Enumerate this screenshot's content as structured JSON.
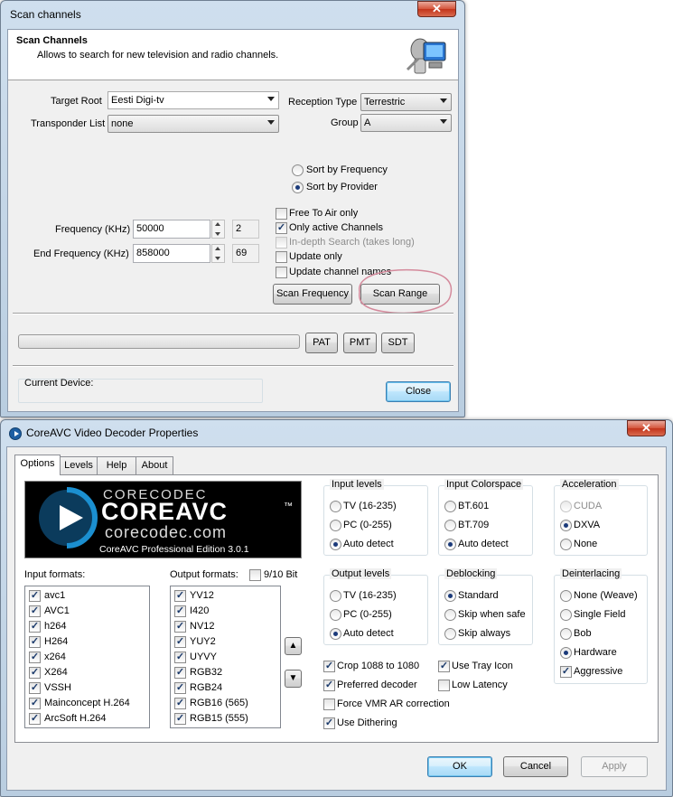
{
  "scan_window": {
    "title": "Scan channels",
    "close": "✕",
    "header_title": "Scan Channels",
    "header_desc": "Allows to search for new television and radio channels.",
    "target_root_label": "Target Root",
    "target_root_value": "Eesti Digi-tv",
    "transponder_list_label": "Transponder List",
    "transponder_list_value": "none",
    "reception_type_label": "Reception Type",
    "reception_type_value": "Terrestric",
    "group_label": "Group",
    "group_value": "A",
    "sort_by_frequency": "Sort by Frequency",
    "sort_by_provider": "Sort by Provider",
    "frequency_label": "Frequency (KHz)",
    "frequency_value": "50000",
    "frequency_channel": "2",
    "end_frequency_label": "End  Frequency (KHz)",
    "end_frequency_value": "858000",
    "end_frequency_channel": "69",
    "free_to_air": "Free To Air only",
    "only_active": "Only active Channels",
    "in_depth": "In-depth Search (takes long)",
    "update_only": "Update only",
    "update_names": "Update channel names",
    "scan_frequency": "Scan Frequency",
    "scan_range": "Scan Range",
    "pat": "PAT",
    "pmt": "PMT",
    "sdt": "SDT",
    "current_device_label": "Current Device:",
    "close_button": "Close"
  },
  "coreavc_window": {
    "title": "CoreAVC Video Decoder Properties",
    "close": "✕",
    "tabs": [
      "Options",
      "Levels",
      "Help",
      "About"
    ],
    "logo": {
      "brand_small": "CORECODEC",
      "brand_big": "COREAVC",
      "tm": "™",
      "url": "corecodec.com",
      "edition": "CoreAVC Professional Edition 3.0.1"
    },
    "input_formats_label": "Input formats:",
    "input_formats": [
      "avc1",
      "AVC1",
      "h264",
      "H264",
      "x264",
      "X264",
      "VSSH",
      "Mainconcept H.264",
      "ArcSoft H.264"
    ],
    "output_formats_label": "Output formats:",
    "bit_label": "9/10 Bit",
    "output_formats": [
      "YV12",
      "I420",
      "NV12",
      "YUY2",
      "UYVY",
      "RGB32",
      "RGB24",
      "RGB16 (565)",
      "RGB15 (555)"
    ],
    "move_up": "▲",
    "move_down": "▼",
    "input_levels": {
      "title": "Input levels",
      "options": [
        "TV (16-235)",
        "PC (0-255)",
        "Auto detect"
      ],
      "selected": 2
    },
    "input_colorspace": {
      "title": "Input Colorspace",
      "options": [
        "BT.601",
        "BT.709",
        "Auto detect"
      ],
      "selected": 2
    },
    "acceleration": {
      "title": "Acceleration",
      "options": [
        "CUDA",
        "DXVA",
        "None"
      ],
      "selected": 1
    },
    "output_levels": {
      "title": "Output levels",
      "options": [
        "TV (16-235)",
        "PC (0-255)",
        "Auto detect"
      ],
      "selected": 2
    },
    "deblocking": {
      "title": "Deblocking",
      "options": [
        "Standard",
        "Skip when safe",
        "Skip always"
      ],
      "selected": 0
    },
    "deinterlacing": {
      "title": "Deinterlacing",
      "options": [
        "None (Weave)",
        "Single Field",
        "Bob",
        "Hardware"
      ],
      "selected": 3,
      "aggressive": "Aggressive"
    },
    "crop": "Crop 1088 to 1080",
    "preferred": "Preferred decoder",
    "force_vmr": "Force VMR AR correction",
    "dithering": "Use Dithering",
    "tray_icon": "Use Tray Icon",
    "low_latency": "Low Latency",
    "ok": "OK",
    "cancel": "Cancel",
    "apply": "Apply",
    "check_mark": "✓"
  }
}
